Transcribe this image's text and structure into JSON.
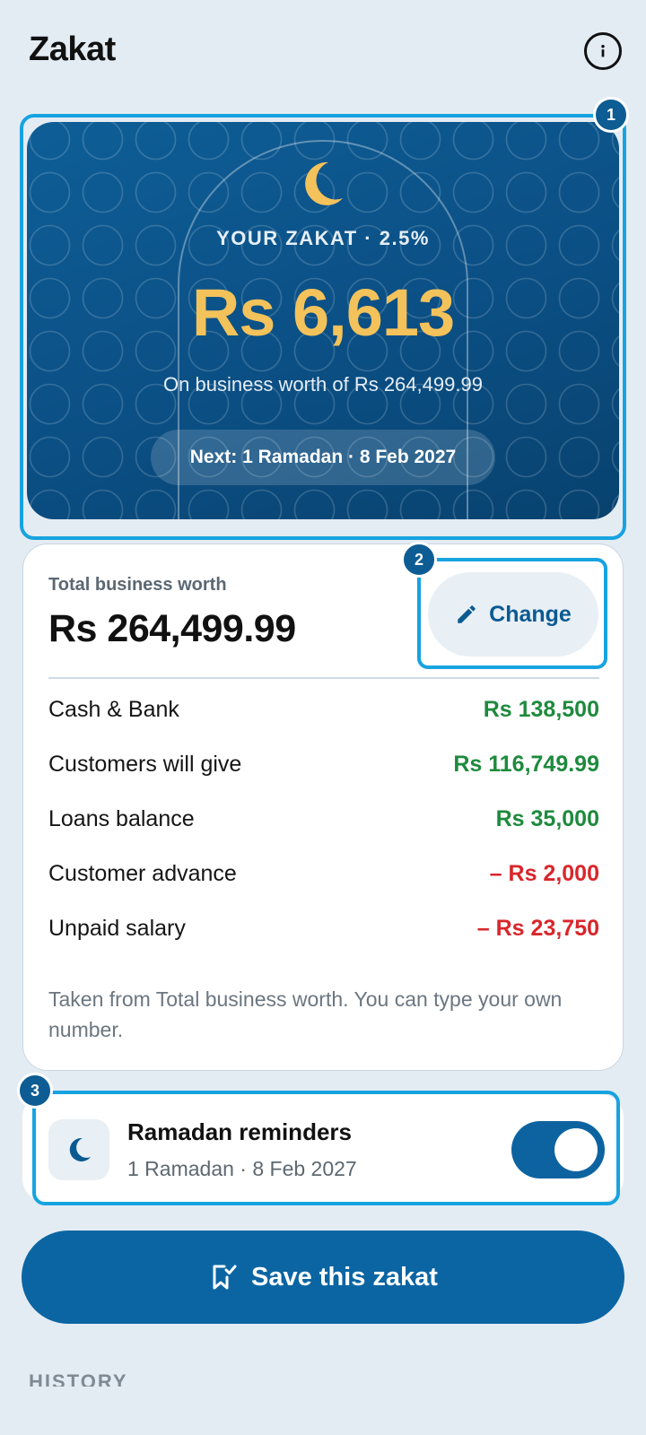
{
  "header": {
    "title": "Zakat",
    "info_icon": "info-icon"
  },
  "hero": {
    "label": "YOUR ZAKAT · 2.5%",
    "amount": "Rs 6,613",
    "subtitle": "On business worth of Rs 264,499.99",
    "next": "Next: 1 Ramadan · 8 Feb 2027",
    "icon": "crescent-moon-icon",
    "badge": "1",
    "colors": {
      "background": "#0b4f84",
      "amount": "#f4c25a"
    }
  },
  "worth": {
    "label": "Total business worth",
    "value": "Rs 264,499.99",
    "change_label": "Change",
    "change_badge": "2",
    "items": [
      {
        "label": "Cash & Bank",
        "value": "Rs 138,500",
        "type": "positive"
      },
      {
        "label": "Customers will give",
        "value": "Rs 116,749.99",
        "type": "positive"
      },
      {
        "label": "Loans balance",
        "value": "Rs 35,000",
        "type": "positive"
      },
      {
        "label": "Customer advance",
        "value": "– Rs 2,000",
        "type": "negative"
      },
      {
        "label": "Unpaid salary",
        "value": "– Rs 23,750",
        "type": "negative"
      }
    ],
    "note": "Taken from Total business worth. You can type your own number.",
    "colors": {
      "positive": "#1e8a3d",
      "negative": "#d9262b"
    }
  },
  "reminder": {
    "badge": "3",
    "title": "Ramadan reminders",
    "subtitle": "1 Ramadan · 8 Feb 2027",
    "enabled": true
  },
  "save": {
    "label": "Save this zakat",
    "icon": "bookmark-check-icon"
  },
  "history": {
    "label": "HISTORY"
  },
  "accent": "#0b65a3"
}
